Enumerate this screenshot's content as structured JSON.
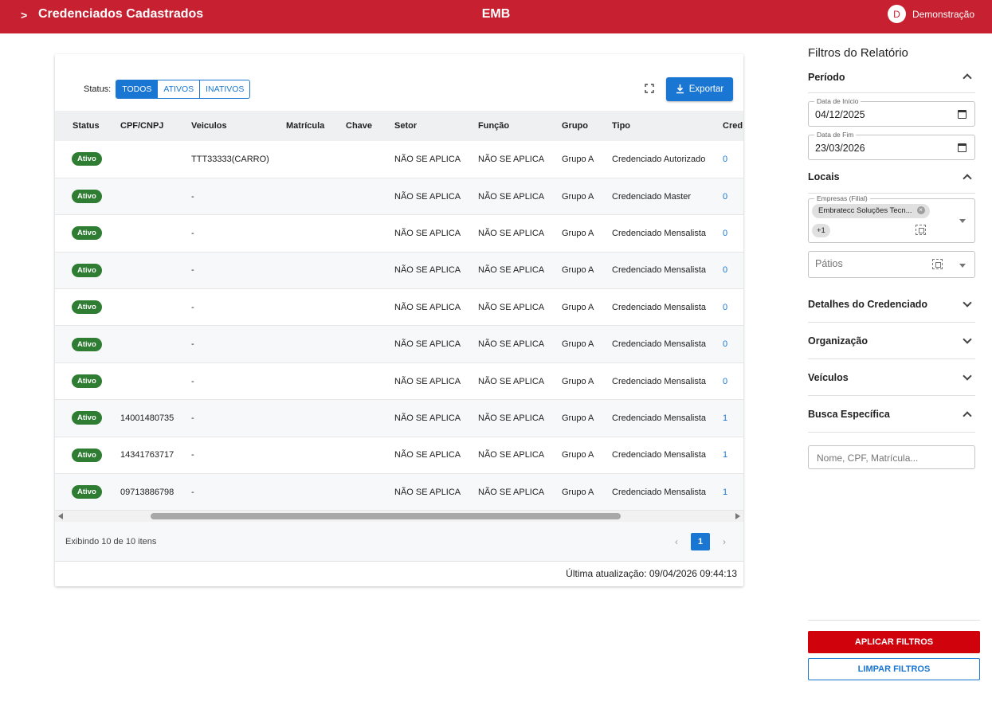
{
  "header": {
    "title": "Credenciados Cadastrados",
    "center": "EMB",
    "user_initial": "D",
    "user_name": "Demonstração"
  },
  "toolbar": {
    "status_label": "Status:",
    "filters": [
      "TODOS",
      "ATIVOS",
      "INATIVOS"
    ],
    "export_label": "Exportar"
  },
  "table": {
    "columns": [
      "Status",
      "CPF/CNPJ",
      "Veiculos",
      "Matrícula",
      "Chave",
      "Setor",
      "Função",
      "Grupo",
      "Tipo",
      "Cred"
    ],
    "rows": [
      [
        "Ativo",
        "",
        "TTT33333(CARRO)",
        "",
        "",
        "NÃO SE APLICA",
        "NÃO SE APLICA",
        "Grupo A",
        "Credenciado Autorizado",
        "0"
      ],
      [
        "Ativo",
        "",
        "-",
        "",
        "",
        "NÃO SE APLICA",
        "NÃO SE APLICA",
        "Grupo A",
        "Credenciado Master",
        "0"
      ],
      [
        "Ativo",
        "",
        "-",
        "",
        "",
        "NÃO SE APLICA",
        "NÃO SE APLICA",
        "Grupo A",
        "Credenciado Mensalista",
        "0"
      ],
      [
        "Ativo",
        "",
        "-",
        "",
        "",
        "NÃO SE APLICA",
        "NÃO SE APLICA",
        "Grupo A",
        "Credenciado Mensalista",
        "0"
      ],
      [
        "Ativo",
        "",
        "-",
        "",
        "",
        "NÃO SE APLICA",
        "NÃO SE APLICA",
        "Grupo A",
        "Credenciado Mensalista",
        "0"
      ],
      [
        "Ativo",
        "",
        "-",
        "",
        "",
        "NÃO SE APLICA",
        "NÃO SE APLICA",
        "Grupo A",
        "Credenciado Mensalista",
        "0"
      ],
      [
        "Ativo",
        "",
        "-",
        "",
        "",
        "NÃO SE APLICA",
        "NÃO SE APLICA",
        "Grupo A",
        "Credenciado Mensalista",
        "0"
      ],
      [
        "Ativo",
        "14001480735",
        "-",
        "",
        "",
        "NÃO SE APLICA",
        "NÃO SE APLICA",
        "Grupo A",
        "Credenciado Mensalista",
        "1"
      ],
      [
        "Ativo",
        "14341763717",
        "-",
        "",
        "",
        "NÃO SE APLICA",
        "NÃO SE APLICA",
        "Grupo A",
        "Credenciado Mensalista",
        "1"
      ],
      [
        "Ativo",
        "09713886798",
        "-",
        "",
        "",
        "NÃO SE APLICA",
        "NÃO SE APLICA",
        "Grupo A",
        "Credenciado Mensalista",
        "1"
      ]
    ]
  },
  "footer": {
    "count_text": "Exibindo 10 de 10 itens",
    "current_page": "1",
    "prev": "‹",
    "next": "›",
    "updated": "Última atualização: 09/04/2026 09:44:13"
  },
  "sidebar": {
    "title": "Filtros do Relatório",
    "periodo": {
      "label": "Período",
      "start_label": "Data de Início",
      "start_value": "04/12/2025",
      "end_label": "Data de Fim",
      "end_value": "23/03/2026"
    },
    "locais": {
      "label": "Locais",
      "empresas_label": "Empresas (Filial)",
      "empresa_chip": "Embratecc Soluções Tecn...",
      "more_chip": "+1",
      "patios_placeholder": "Pátios"
    },
    "detalhes": "Detalhes do Credenciado",
    "organizacao": "Organização",
    "veiculos": "Veículos",
    "busca": {
      "label": "Busca Específica",
      "placeholder": "Nome, CPF, Matrícula..."
    },
    "apply": "APLICAR FILTROS",
    "clear": "LIMPAR FILTROS"
  },
  "colors": {
    "brand": "#c62031",
    "primary": "#1976d2",
    "active_badge": "#2e7d32",
    "apply": "#d0020b"
  }
}
